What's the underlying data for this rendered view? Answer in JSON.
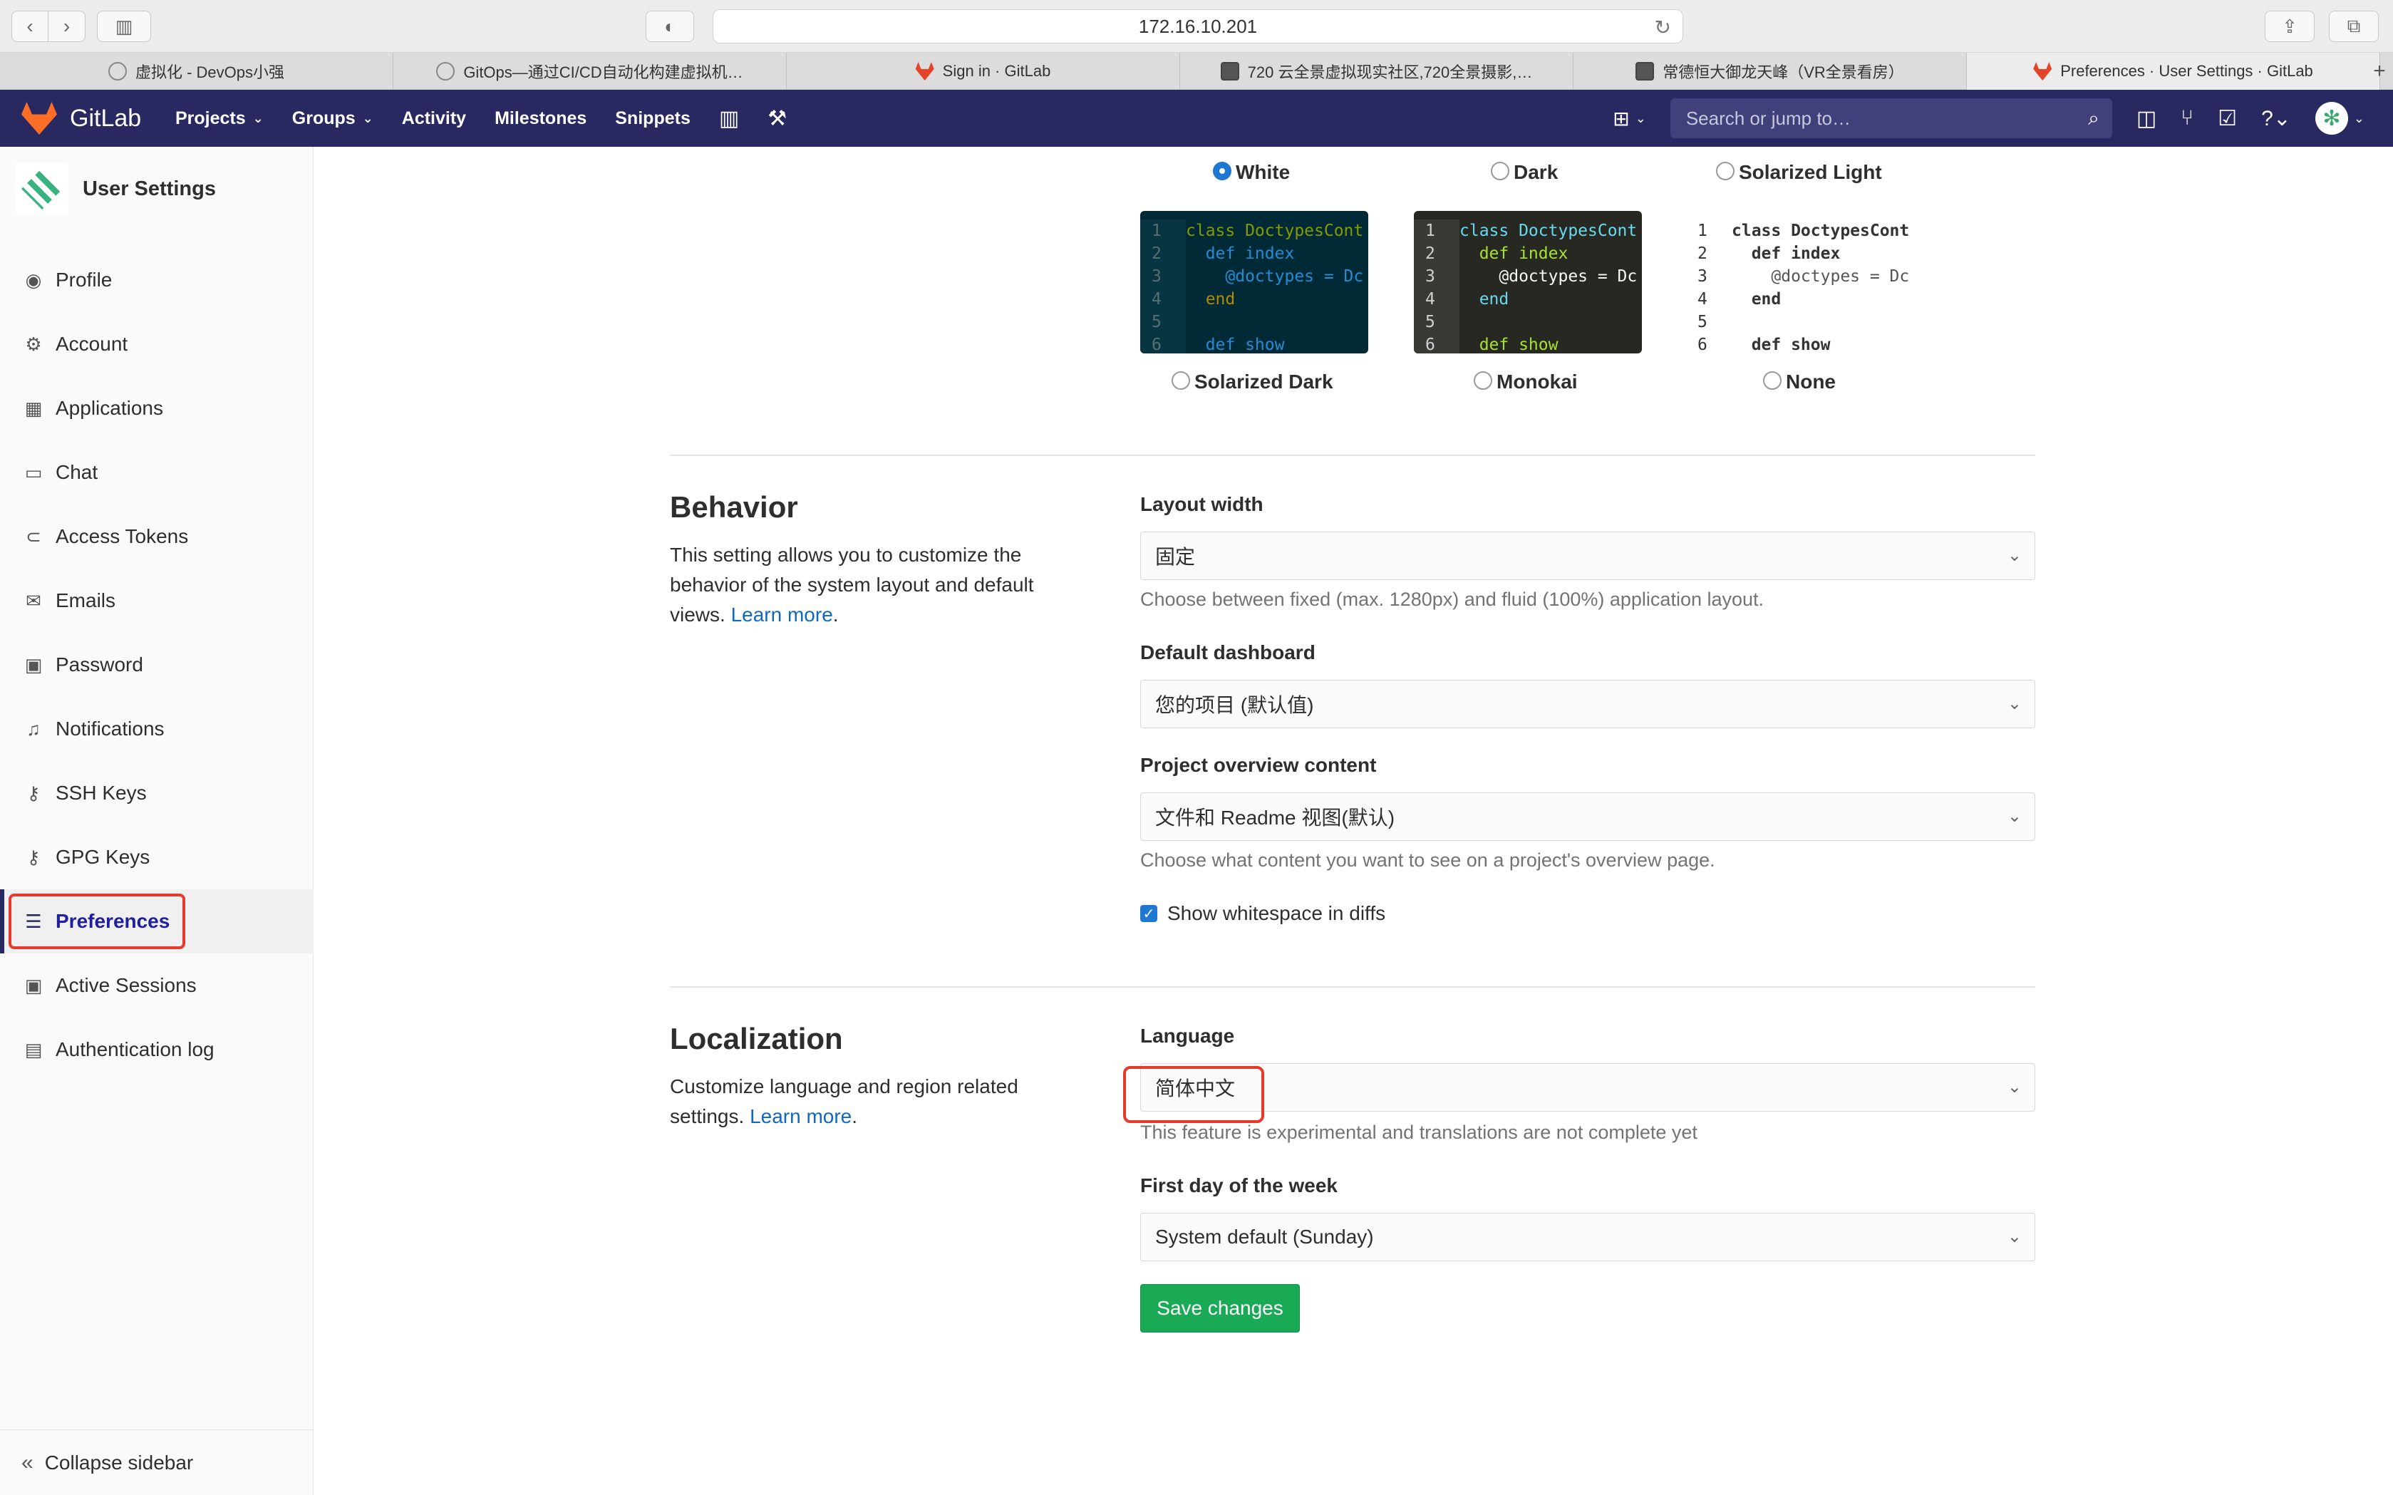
{
  "browser": {
    "address": "172.16.10.201",
    "tabs": [
      {
        "label": "虚拟化 - DevOps小强",
        "icon": "circle"
      },
      {
        "label": "GitOps—通过CI/CD自动化构建虚拟机…",
        "icon": "circle"
      },
      {
        "label": "Sign in · GitLab",
        "icon": "fox"
      },
      {
        "label": "720 云全景虚拟现实社区,720全景摄影,…",
        "icon": "square"
      },
      {
        "label": "常德恒大御龙天峰（VR全景看房）",
        "icon": "square"
      },
      {
        "label": "Preferences · User Settings · GitLab",
        "icon": "fox"
      }
    ]
  },
  "navbar": {
    "brand": "GitLab",
    "links": [
      "Projects",
      "Groups",
      "Activity",
      "Milestones",
      "Snippets"
    ],
    "search_placeholder": "Search or jump to…"
  },
  "sidebar": {
    "title": "User Settings",
    "items": [
      {
        "label": "Profile",
        "icon": "user-circle-icon",
        "glyph": "◉"
      },
      {
        "label": "Account",
        "icon": "account-icon",
        "glyph": "⚙"
      },
      {
        "label": "Applications",
        "icon": "grid-icon",
        "glyph": "▦"
      },
      {
        "label": "Chat",
        "icon": "chat-icon",
        "glyph": "▭"
      },
      {
        "label": "Access Tokens",
        "icon": "token-icon",
        "glyph": "⊂"
      },
      {
        "label": "Emails",
        "icon": "mail-icon",
        "glyph": "✉"
      },
      {
        "label": "Password",
        "icon": "lock-icon",
        "glyph": "🔒"
      },
      {
        "label": "Notifications",
        "icon": "bell-icon",
        "glyph": "🔔"
      },
      {
        "label": "SSH Keys",
        "icon": "key-icon",
        "glyph": "⚷"
      },
      {
        "label": "GPG Keys",
        "icon": "key-icon",
        "glyph": "⚷"
      },
      {
        "label": "Preferences",
        "icon": "sliders-icon",
        "glyph": "☰"
      },
      {
        "label": "Active Sessions",
        "icon": "monitor-icon",
        "glyph": "▣"
      },
      {
        "label": "Authentication log",
        "icon": "log-icon",
        "glyph": "▤"
      }
    ],
    "active": "Preferences",
    "collapse_label": "Collapse sidebar"
  },
  "themes": {
    "top_row": [
      {
        "label": "White",
        "selected": true
      },
      {
        "label": "Dark",
        "selected": false
      },
      {
        "label": "Solarized Light",
        "selected": false
      }
    ],
    "bottom_row": [
      {
        "label": "Solarized Dark",
        "selected": false
      },
      {
        "label": "Monokai",
        "selected": false
      },
      {
        "label": "None",
        "selected": false
      }
    ],
    "code_sample": {
      "line_numbers": [
        "1",
        "2",
        "3",
        "4",
        "5",
        "6"
      ],
      "lines": [
        "class DoctypesCont",
        "  def index",
        "    @doctypes = Dc",
        "  end",
        "",
        "  def show"
      ]
    }
  },
  "behavior": {
    "title": "Behavior",
    "description": "This setting allows you to customize the behavior of the system layout and default views.",
    "learn_more": "Learn more",
    "layout_width": {
      "label": "Layout width",
      "value": "固定",
      "help": "Choose between fixed (max. 1280px) and fluid (100%) application layout."
    },
    "default_dashboard": {
      "label": "Default dashboard",
      "value": "您的项目 (默认值)"
    },
    "project_overview": {
      "label": "Project overview content",
      "value": "文件和 Readme 视图(默认)",
      "help": "Choose what content you want to see on a project's overview page."
    },
    "whitespace": {
      "label": "Show whitespace in diffs",
      "checked": true
    }
  },
  "localization": {
    "title": "Localization",
    "description": "Customize language and region related settings.",
    "learn_more": "Learn more",
    "language": {
      "label": "Language",
      "value": "简体中文",
      "help": "This feature is experimental and translations are not complete yet"
    },
    "first_day": {
      "label": "First day of the week",
      "value": "System default (Sunday)"
    }
  },
  "save_label": "Save changes",
  "colors": {
    "navbar": "#292961",
    "accent": "#1f78d1",
    "save": "#1aaa55",
    "highlight": "#e8392d"
  }
}
